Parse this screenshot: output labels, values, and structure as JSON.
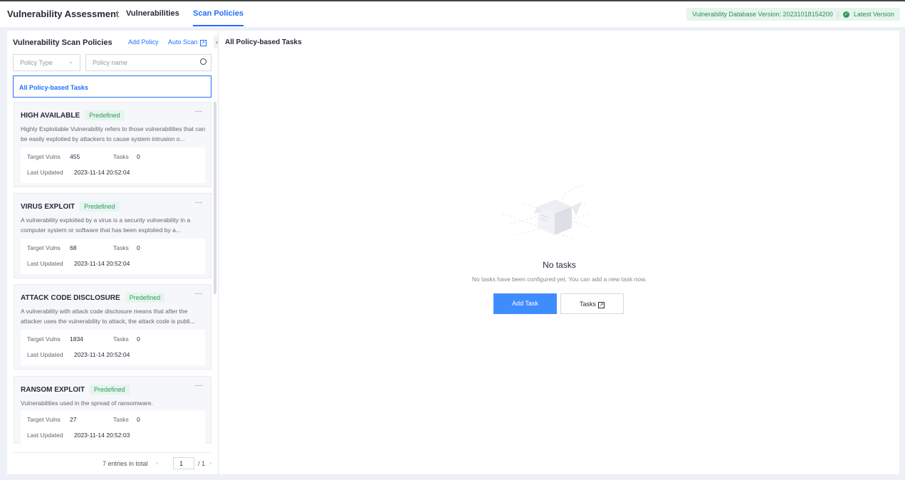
{
  "header": {
    "title": "Vulnerability Assessment",
    "tabs": [
      {
        "label": "Vulnerabilities"
      },
      {
        "label": "Scan Policies"
      }
    ],
    "db_version": "Vulnerability Database Version: 20231018154200",
    "latest": "Latest Version"
  },
  "sidebar": {
    "title": "Vulnerability Scan Policies",
    "add_policy": "Add Policy",
    "auto_scan": "Auto Scan",
    "policy_type_placeholder": "Policy Type",
    "policy_name_placeholder": "Policy name",
    "all_tasks": "All Policy-based Tasks",
    "labels": {
      "target": "Target Vulns",
      "tasks": "Tasks",
      "updated": "Last Updated"
    },
    "policies": [
      {
        "name": "HIGH AVAILABLE",
        "badge": "Predefined",
        "desc": "Highly Exploitable Vulnerability refers to those vulnerabilities that can be easily exploited by attackers to cause system intrusion o...",
        "target": "455",
        "tasks": "0",
        "updated": "2023-11-14 20:52:04"
      },
      {
        "name": "VIRUS EXPLOIT",
        "badge": "Predefined",
        "desc": "A vulnerability exploited by a virus is a security vulnerability in a computer system or software that has been exploited by a...",
        "target": "68",
        "tasks": "0",
        "updated": "2023-11-14 20:52:04"
      },
      {
        "name": "ATTACK CODE DISCLOSURE",
        "badge": "Predefined",
        "desc": "A vulnerability with attack code disclosure means that after the attacker uses the vulnerability to attack, the attack code is publi...",
        "target": "1834",
        "tasks": "0",
        "updated": "2023-11-14 20:52:04"
      },
      {
        "name": "RANSOM EXPLOIT",
        "badge": "Predefined",
        "desc": "Vulnerabilities used in the spread of ransomware.",
        "target": "27",
        "tasks": "0",
        "updated": "2023-11-14 20:52:03"
      }
    ],
    "pagination": {
      "total": "7 entries in total",
      "page": "1",
      "of": "/ 1"
    }
  },
  "main": {
    "title": "All Policy-based Tasks",
    "empty_title": "No tasks",
    "empty_desc": "No tasks have been configured yet. You can add a new task now.",
    "add_task": "Add Task",
    "tasks": "Tasks"
  }
}
